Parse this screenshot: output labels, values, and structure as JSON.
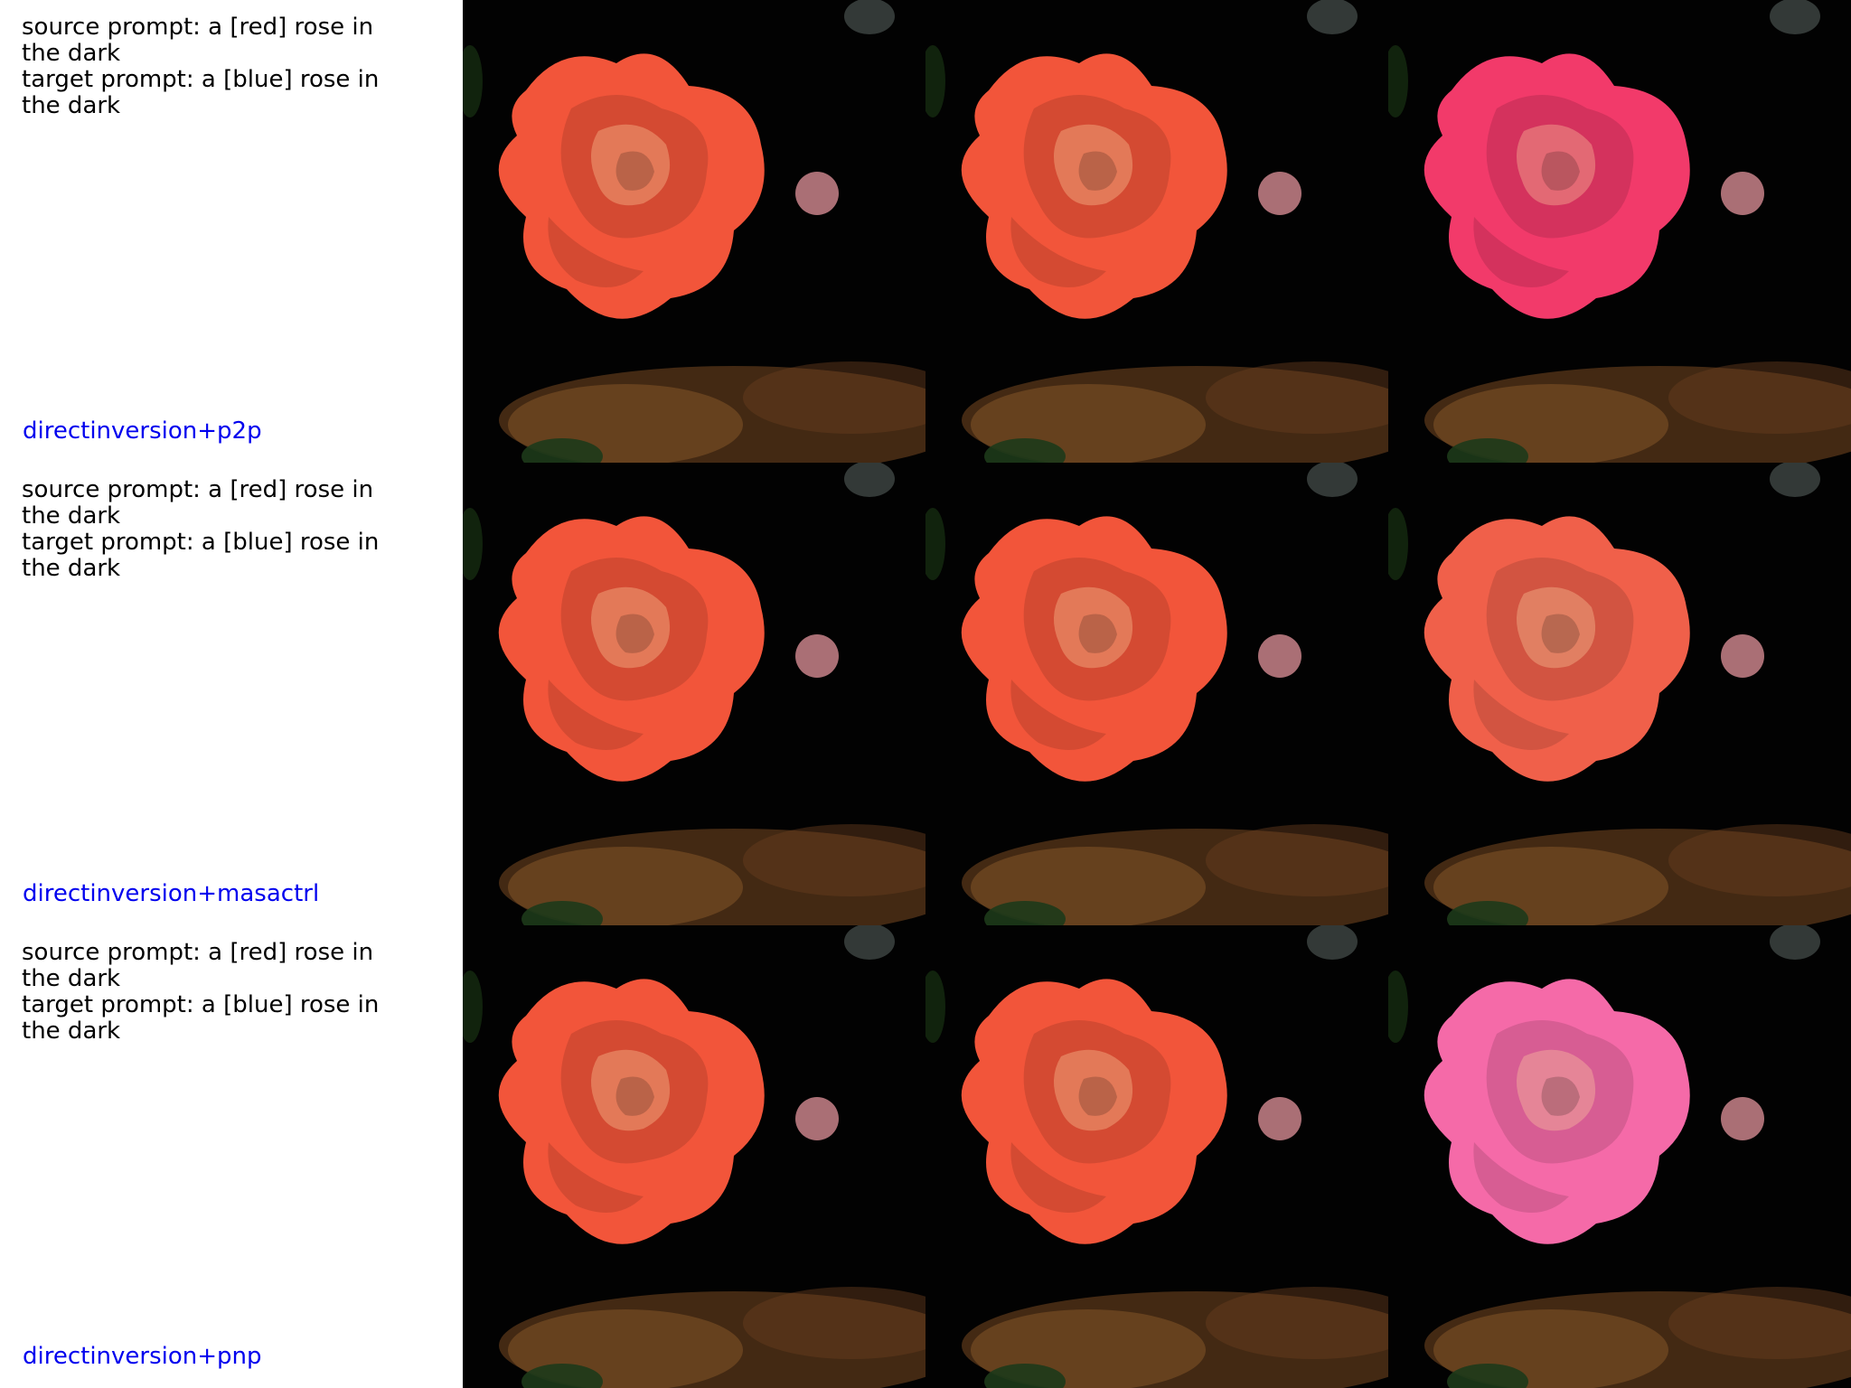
{
  "rows": [
    {
      "source_prompt": "source prompt: a [red] rose in the dark",
      "target_prompt": "target prompt: a [blue] rose in the dark",
      "method": "directinversion+p2p",
      "images": [
        "source rose photo",
        "reconstructed rose",
        "edited rose (pink)"
      ]
    },
    {
      "source_prompt": "source prompt: a [red] rose in the dark",
      "target_prompt": "target prompt: a [blue] rose in the dark",
      "method": "directinversion+masactrl",
      "images": [
        "source rose photo",
        "reconstructed rose",
        "edited rose (coral)"
      ]
    },
    {
      "source_prompt": "source prompt: a [red] rose in the dark",
      "target_prompt": "target prompt: a [blue] rose in the dark",
      "method": "directinversion+pnp",
      "images": [
        "source rose photo",
        "reconstructed rose",
        "edited rose (light pink)"
      ]
    }
  ],
  "colors": {
    "label_link": "#0000ee",
    "rose_source": "#f2553a",
    "rose_edit_p2p": "#f23a6a",
    "rose_edit_masactrl": "#f0604a",
    "rose_edit_pnp": "#f56aa8",
    "background": "#000000"
  }
}
